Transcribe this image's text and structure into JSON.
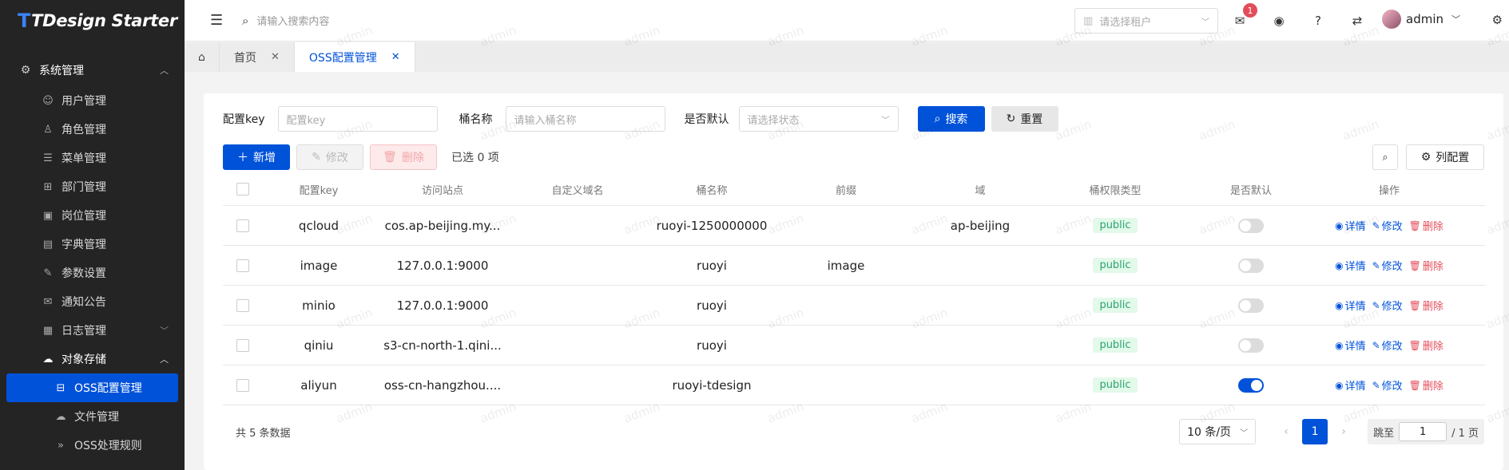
{
  "app": {
    "logo_mark": "T",
    "logo_text": "TDesign Starter"
  },
  "sidebar": {
    "group": {
      "label": "系统管理"
    },
    "items": [
      {
        "label": "用户管理",
        "icon": "user-icon"
      },
      {
        "label": "角色管理",
        "icon": "role-icon"
      },
      {
        "label": "菜单管理",
        "icon": "menu-list-icon"
      },
      {
        "label": "部门管理",
        "icon": "org-icon"
      },
      {
        "label": "岗位管理",
        "icon": "post-icon"
      },
      {
        "label": "字典管理",
        "icon": "book-icon"
      },
      {
        "label": "参数设置",
        "icon": "edit-icon"
      },
      {
        "label": "通知公告",
        "icon": "mail-icon"
      },
      {
        "label": "日志管理",
        "icon": "log-icon"
      },
      {
        "label": "对象存储",
        "icon": "cloud-icon"
      }
    ],
    "sub_items": [
      {
        "label": "OSS配置管理",
        "icon": "storage-icon"
      },
      {
        "label": "文件管理",
        "icon": "cloud-upload-icon"
      },
      {
        "label": "OSS处理规则",
        "icon": "double-chevron-icon"
      }
    ]
  },
  "header": {
    "search_placeholder": "请输入搜索内容",
    "tenant_placeholder": "请选择租户",
    "notification_count": "1",
    "username": "admin"
  },
  "tabs": [
    {
      "label": "首页"
    },
    {
      "label": "OSS配置管理"
    }
  ],
  "filters": {
    "key_label": "配置key",
    "key_placeholder": "配置key",
    "bucket_label": "桶名称",
    "bucket_placeholder": "请输入桶名称",
    "default_label": "是否默认",
    "default_placeholder": "请选择状态",
    "search_button": "搜索",
    "reset_button": "重置"
  },
  "toolbar": {
    "add": "新增",
    "edit": "修改",
    "delete": "删除",
    "selected": "已选 0 项",
    "columns": "列配置"
  },
  "table": {
    "columns": [
      "配置key",
      "访问站点",
      "自定义域名",
      "桶名称",
      "前缀",
      "域",
      "桶权限类型",
      "是否默认",
      "操作"
    ],
    "actions": {
      "detail": "详情",
      "edit": "修改",
      "delete": "删除"
    },
    "rows": [
      {
        "key": "qcloud",
        "site": "cos.ap-beijing.my...",
        "domain": "",
        "bucket": "ruoyi-1250000000",
        "prefix": "",
        "region": "ap-beijing",
        "acl": "public",
        "is_default": false
      },
      {
        "key": "image",
        "site": "127.0.0.1:9000",
        "domain": "",
        "bucket": "ruoyi",
        "prefix": "image",
        "region": "",
        "acl": "public",
        "is_default": false
      },
      {
        "key": "minio",
        "site": "127.0.0.1:9000",
        "domain": "",
        "bucket": "ruoyi",
        "prefix": "",
        "region": "",
        "acl": "public",
        "is_default": false
      },
      {
        "key": "qiniu",
        "site": "s3-cn-north-1.qini...",
        "domain": "",
        "bucket": "ruoyi",
        "prefix": "",
        "region": "",
        "acl": "public",
        "is_default": false
      },
      {
        "key": "aliyun",
        "site": "oss-cn-hangzhou....",
        "domain": "",
        "bucket": "ruoyi-tdesign",
        "prefix": "",
        "region": "",
        "acl": "public",
        "is_default": true
      }
    ]
  },
  "pagination": {
    "total_text": "共 5 条数据",
    "page_size": "10 条/页",
    "current_page": "1",
    "jump_label": "跳至",
    "jump_value": "1",
    "total_pages": "/ 1 页"
  },
  "watermark": "admin",
  "colors": {
    "primary": "#0052d9",
    "sidebar_bg": "#242424",
    "danger": "#e34d59",
    "tag_bg": "#e3f9e9",
    "tag_text": "#2ba471"
  }
}
